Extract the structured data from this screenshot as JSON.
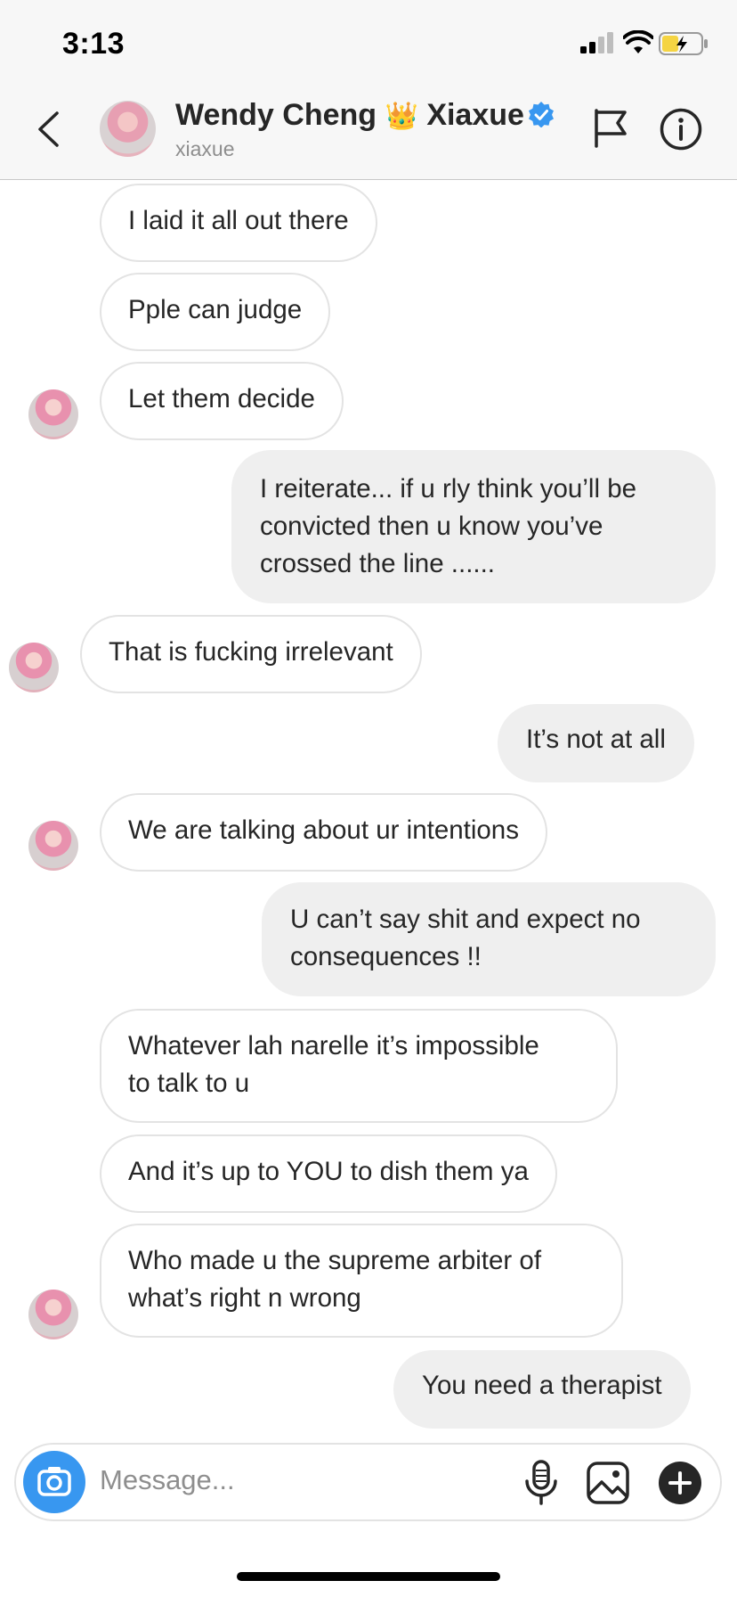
{
  "status_bar": {
    "time": "3:13"
  },
  "header": {
    "name": "Wendy Cheng",
    "crown_emoji": "👑",
    "name_suffix": "Xiaxue",
    "username": "xiaxue",
    "icons": [
      "back-chevron-icon",
      "verified-badge-icon",
      "flag-icon",
      "info-icon"
    ]
  },
  "messages": [
    {
      "from": "them",
      "text": "I laid it all out there"
    },
    {
      "from": "them",
      "text": "Pple can judge"
    },
    {
      "from": "them",
      "text": "Let them decide"
    },
    {
      "from": "me",
      "lines": [
        "I reiterate... if u rly think you’ll be",
        "convicted then u know you’ve",
        "crossed the line ......"
      ]
    },
    {
      "from": "them",
      "text": "That is fucking irrelevant"
    },
    {
      "from": "me",
      "text": "It’s not at all"
    },
    {
      "from": "them",
      "text": "We are talking about ur intentions"
    },
    {
      "from": "me",
      "lines": [
        "U can’t say shit and expect no",
        "consequences !!"
      ]
    },
    {
      "from": "them",
      "lines": [
        "Whatever lah narelle it’s impossible",
        "to talk to u"
      ]
    },
    {
      "from": "them",
      "text": "And it’s up to YOU to dish them ya"
    },
    {
      "from": "them",
      "lines": [
        "Who made u the supreme arbiter of",
        "what’s right n wrong"
      ]
    },
    {
      "from": "me",
      "text": "You need a therapist"
    }
  ],
  "composer": {
    "placeholder": "Message...",
    "icons": [
      "camera-icon",
      "microphone-icon",
      "gallery-icon",
      "plus-icon"
    ]
  },
  "colors": {
    "verified_blue": "#3897f0",
    "outgoing_bubble": "#efefef",
    "incoming_border": "#e3e3e3",
    "header_bg": "#f7f7f7"
  }
}
